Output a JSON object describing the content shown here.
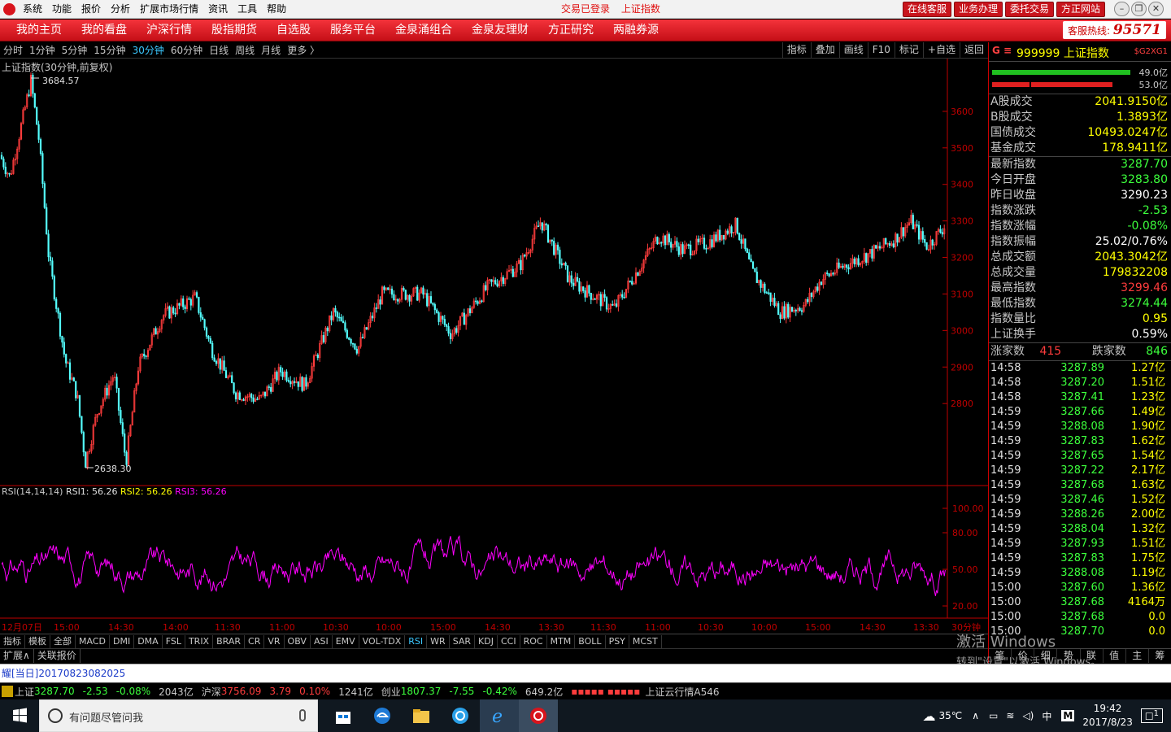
{
  "titlebar": {
    "menu": [
      "系统",
      "功能",
      "报价",
      "分析",
      "扩展市场行情",
      "资讯",
      "工具",
      "帮助"
    ],
    "status_login": "交易已登录",
    "status_index": "上证指数",
    "buttons": [
      "在线客服",
      "业务办理",
      "委托交易",
      "方正网站"
    ]
  },
  "navbar": {
    "items": [
      "我的主页",
      "我的看盘",
      "沪深行情",
      "股指期货",
      "自选股",
      "服务平台",
      "金泉涌组合",
      "金泉友理财",
      "方正研究",
      "两融券源"
    ],
    "hotline_label": "客服热线:",
    "hotline_number": "95571"
  },
  "period_bar": {
    "periods": [
      "分时",
      "1分钟",
      "5分钟",
      "15分钟",
      "30分钟",
      "60分钟",
      "日线",
      "周线",
      "月线",
      "更多 〉"
    ],
    "active": "30分钟",
    "tools": [
      "指标",
      "叠加",
      "画线",
      "F10",
      "标记",
      "+自选",
      "返回"
    ]
  },
  "main_chart": {
    "title": "上证指数(30分钟,前复权)",
    "high_label": "3684.57",
    "low_label": "2638.30",
    "y_ticks": [
      "3600",
      "3500",
      "3400",
      "3300",
      "3200",
      "3100",
      "3000",
      "2900",
      "2800"
    ]
  },
  "rsi": {
    "label": "RSI(14,14,14)",
    "rsi1": "RSI1: 56.26",
    "rsi2": "RSI2: 56.26",
    "rsi3": "RSI3: 56.26",
    "y_ticks": [
      "100.00",
      "80.00",
      "50.00",
      "20.00"
    ],
    "x_labels": [
      "12月07日",
      "15:00",
      "14:30",
      "14:00",
      "11:30",
      "11:00",
      "10:30",
      "10:00",
      "15:00",
      "14:30",
      "13:30",
      "11:30",
      "11:00",
      "10:30",
      "10:00",
      "15:00",
      "14:30",
      "13:30",
      "30分钟"
    ]
  },
  "indicator_tabs": [
    "指标",
    "模板",
    "全部",
    "MACD",
    "DMI",
    "DMA",
    "FSL",
    "TRIX",
    "BRAR",
    "CR",
    "VR",
    "OBV",
    "ASI",
    "EMV",
    "VOL-TDX",
    "RSI",
    "WR",
    "SAR",
    "KDJ",
    "CCI",
    "ROC",
    "MTM",
    "BOLL",
    "PSY",
    "MCST"
  ],
  "indicator_active": "RSI",
  "expand_bar": [
    "扩展∧",
    "关联报价"
  ],
  "right_panel": {
    "code": "999999",
    "name": "上证指数",
    "tag": "$G2XG1",
    "ratio_up": "49.0亿",
    "ratio_down": "53.0亿",
    "volumes": [
      {
        "k": "A股成交",
        "v": "2041.9150亿"
      },
      {
        "k": "B股成交",
        "v": "1.3893亿"
      },
      {
        "k": "国债成交",
        "v": "10493.0247亿"
      },
      {
        "k": "基金成交",
        "v": "178.9411亿"
      }
    ],
    "stats": [
      {
        "k": "最新指数",
        "v": "3287.70",
        "c": "#3cff3c"
      },
      {
        "k": "今日开盘",
        "v": "3283.80",
        "c": "#3cff3c"
      },
      {
        "k": "昨日收盘",
        "v": "3290.23",
        "c": "#ffffff"
      },
      {
        "k": "指数涨跌",
        "v": "-2.53",
        "c": "#3cff3c"
      },
      {
        "k": "指数涨幅",
        "v": "-0.08%",
        "c": "#3cff3c"
      },
      {
        "k": "指数振幅",
        "v": "25.02/0.76%",
        "c": "#ffffff"
      },
      {
        "k": "总成交额",
        "v": "2043.3042亿",
        "c": "#ffff00"
      },
      {
        "k": "总成交量",
        "v": "179832208",
        "c": "#ffff00"
      },
      {
        "k": "最高指数",
        "v": "3299.46",
        "c": "#ff3c3c"
      },
      {
        "k": "最低指数",
        "v": "3274.44",
        "c": "#3cff3c"
      },
      {
        "k": "指数量比",
        "v": "0.95",
        "c": "#ffff00"
      },
      {
        "k": "上证换手",
        "v": "0.59%",
        "c": "#ffffff"
      }
    ],
    "up_label": "涨家数",
    "up_count": "415",
    "down_label": "跌家数",
    "down_count": "846",
    "ticks": [
      [
        "14:58",
        "3287.89",
        "1.27亿"
      ],
      [
        "14:58",
        "3287.20",
        "1.51亿"
      ],
      [
        "14:58",
        "3287.41",
        "1.23亿"
      ],
      [
        "14:59",
        "3287.66",
        "1.49亿"
      ],
      [
        "14:59",
        "3288.08",
        "1.90亿"
      ],
      [
        "14:59",
        "3287.83",
        "1.62亿"
      ],
      [
        "14:59",
        "3287.65",
        "1.54亿"
      ],
      [
        "14:59",
        "3287.22",
        "2.17亿"
      ],
      [
        "14:59",
        "3287.68",
        "1.63亿"
      ],
      [
        "14:59",
        "3287.46",
        "1.52亿"
      ],
      [
        "14:59",
        "3288.26",
        "2.00亿"
      ],
      [
        "14:59",
        "3288.04",
        "1.32亿"
      ],
      [
        "14:59",
        "3287.93",
        "1.51亿"
      ],
      [
        "14:59",
        "3287.83",
        "1.75亿"
      ],
      [
        "14:59",
        "3288.08",
        "1.19亿"
      ],
      [
        "15:00",
        "3287.60",
        "1.36亿"
      ],
      [
        "15:00",
        "3287.68",
        "4164万"
      ],
      [
        "15:00",
        "3287.68",
        "0.0"
      ],
      [
        "15:00",
        "3287.70",
        "0.0"
      ]
    ],
    "footer": [
      "笔",
      "价",
      "细",
      "势",
      "联",
      "值",
      "主",
      "筹"
    ]
  },
  "watermark": {
    "line1": "激活 Windows",
    "line2": "转到\"设置\"以激活 Windows。"
  },
  "news": "耀[当日]20170823082025",
  "quote_bar": {
    "sh_label": "上证",
    "sh_price": "3287.70",
    "sh_chg": "-2.53",
    "sh_pct": "-0.08%",
    "sh_amt": "2043亿",
    "hs_label": "沪深",
    "hs_price": "3756.09",
    "hs_chg": "3.79",
    "hs_pct": "0.10%",
    "hs_amt": "1241亿",
    "cy_label": "创业",
    "cy_price": "1807.37",
    "cy_chg": "-7.55",
    "cy_pct": "-0.42%",
    "cy_amt": "649.2亿",
    "cloud": "上证云行情A546"
  },
  "taskbar": {
    "search_placeholder": "有问题尽管问我",
    "weather": "35℃",
    "ime": "中",
    "time": "19:42",
    "date": "2017/8/23",
    "notif": "1"
  },
  "colors": {
    "up": "#ff3c3c",
    "down": "#3cff3c",
    "rsi": "#ff00ff",
    "axis": "#c00000",
    "accent": "#3cc8ff",
    "candle_down": "#54ffff"
  }
}
